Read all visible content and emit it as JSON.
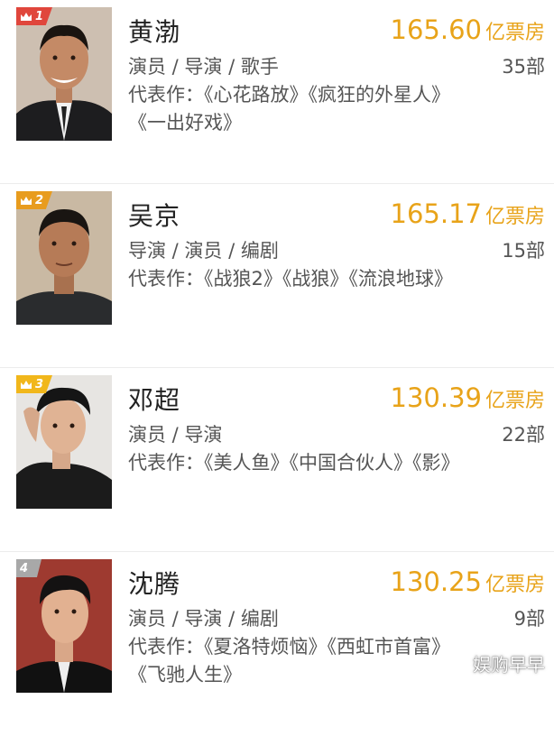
{
  "ranking": {
    "items": [
      {
        "rank": "1",
        "badge_color": "#e0463c",
        "name": "黄渤",
        "gross_value": "165.60",
        "gross_unit": "亿票房",
        "roles": "演员 / 导演 / 歌手",
        "film_count": "35部",
        "works": "代表作：《心花路放》《疯狂的外星人》《一出好戏》",
        "photo_bg": "#cdbfb1"
      },
      {
        "rank": "2",
        "badge_color": "#e89c1e",
        "name": "吴京",
        "gross_value": "165.17",
        "gross_unit": "亿票房",
        "roles": "导演 / 演员 / 编剧",
        "film_count": "15部",
        "works": "代表作：《战狼2》《战狼》《流浪地球》",
        "photo_bg": "#c9b9a3"
      },
      {
        "rank": "3",
        "badge_color": "#f1b71b",
        "name": "邓超",
        "gross_value": "130.39",
        "gross_unit": "亿票房",
        "roles": "演员 / 导演",
        "film_count": "22部",
        "works": "代表作：《美人鱼》《中国合伙人》《影》",
        "photo_bg": "#e7e5e2"
      },
      {
        "rank": "4",
        "badge_color": "#a8a8a8",
        "name": "沈腾",
        "gross_value": "130.25",
        "gross_unit": "亿票房",
        "roles": "演员 / 导演 / 编剧",
        "film_count": "9部",
        "works": "代表作：《夏洛特烦恼》《西虹市首富》《飞驰人生》",
        "photo_bg": "#9e3a30"
      }
    ]
  },
  "watermark": "娱购早早",
  "colors": {
    "accent_gold": "#e8a319",
    "text_dark": "#222222",
    "text_gray": "#555555",
    "divider": "#ececec"
  }
}
